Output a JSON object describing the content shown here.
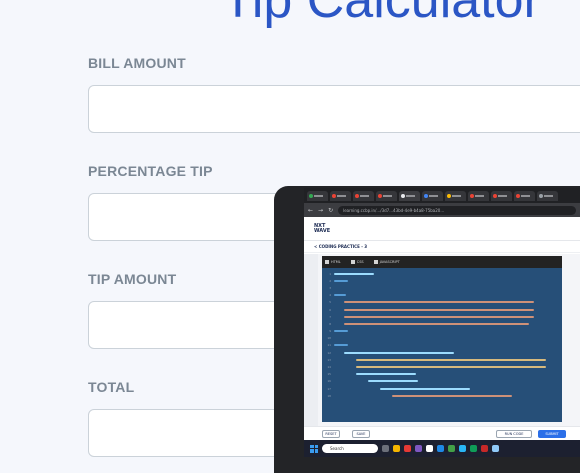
{
  "page": {
    "title": "Tip Calculator",
    "labels": {
      "bill": "BILL AMOUNT",
      "percentage": "PERCENTAGE TIP",
      "tip": "TIP AMOUNT",
      "total": "TOTAL"
    }
  },
  "overlay": {
    "url": "learning.ccbp.in/.../3d7...43bd-4e9-b4a8-75ba20...",
    "brand_line1": "NXT",
    "brand_line2": "WAVE",
    "breadcrumb": "< CODING PRACTICE - 3",
    "editor_tabs": [
      "HTML",
      "CSS",
      "JAVASCRIPT"
    ],
    "reset_label": "RESET",
    "save_label": "SAVE",
    "run_label": "RUN CODE",
    "submit_label": "SUBMIT",
    "taskbar_search": "Search",
    "colors": {
      "title_blue": "#2b56c5",
      "label_gray": "#7b8794",
      "editor_selection": "#264f78"
    }
  }
}
